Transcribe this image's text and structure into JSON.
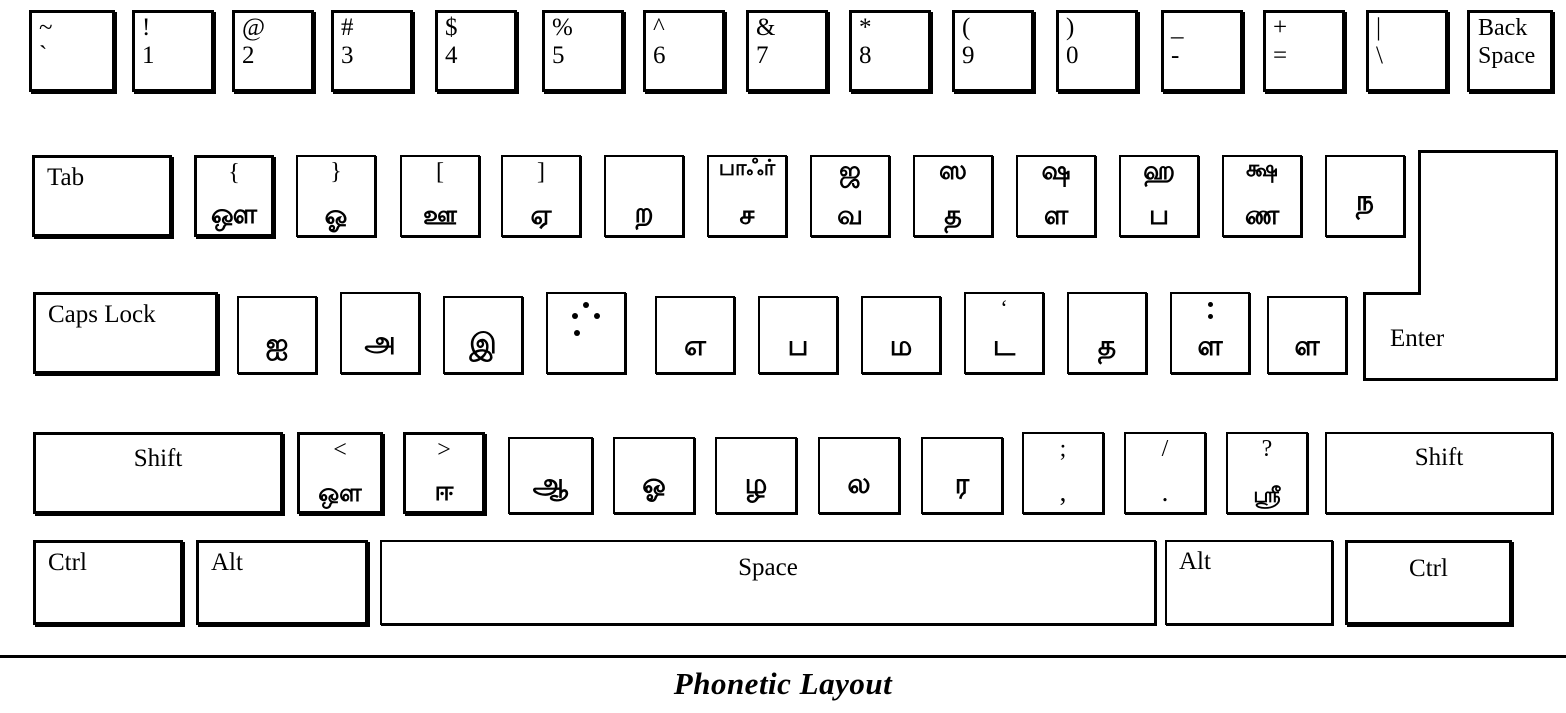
{
  "caption": "Phonetic Layout",
  "rows": {
    "number_row": [
      {
        "name": "key-backquote",
        "top": "~",
        "bottom": "`"
      },
      {
        "name": "key-1",
        "top": "!",
        "bottom": "1"
      },
      {
        "name": "key-2",
        "top": "@",
        "bottom": "2"
      },
      {
        "name": "key-3",
        "top": "#",
        "bottom": "3"
      },
      {
        "name": "key-4",
        "top": "$",
        "bottom": "4"
      },
      {
        "name": "key-5",
        "top": "%",
        "bottom": "5"
      },
      {
        "name": "key-6",
        "top": "^",
        "bottom": "6"
      },
      {
        "name": "key-7",
        "top": "&",
        "bottom": "7"
      },
      {
        "name": "key-8",
        "top": "*",
        "bottom": "8"
      },
      {
        "name": "key-9",
        "top": "(",
        "bottom": "9"
      },
      {
        "name": "key-0",
        "top": ")",
        "bottom": "0"
      },
      {
        "name": "key-minus",
        "top": "_",
        "bottom": "-"
      },
      {
        "name": "key-equals",
        "top": "+",
        "bottom": "="
      },
      {
        "name": "key-backslash",
        "top": "|",
        "bottom": "\\"
      },
      {
        "name": "key-backspace",
        "label": "Back\nSpace"
      }
    ],
    "tab_row": [
      {
        "name": "key-tab",
        "label": "Tab"
      },
      {
        "name": "key-q",
        "top": "{",
        "bottom": "ஔ"
      },
      {
        "name": "key-w",
        "top": "}",
        "bottom": "ஓ"
      },
      {
        "name": "key-e",
        "top": "[",
        "bottom": "ஊ"
      },
      {
        "name": "key-r",
        "top": "]",
        "bottom": "ஏ"
      },
      {
        "name": "key-t",
        "bottom": "ற"
      },
      {
        "name": "key-y",
        "top": "பாஃர்",
        "bottom": "ச"
      },
      {
        "name": "key-u",
        "top": "ஜ",
        "bottom": "வ"
      },
      {
        "name": "key-i",
        "top": "ஸ",
        "bottom": "த"
      },
      {
        "name": "key-o",
        "top": "ஷ",
        "bottom": "ள"
      },
      {
        "name": "key-p",
        "top": "ஹ",
        "bottom": "ப"
      },
      {
        "name": "key-bracketleft",
        "top": "க்ஷ",
        "bottom": "ண"
      },
      {
        "name": "key-bracketright",
        "bottom": "ந"
      }
    ],
    "caps_row": [
      {
        "name": "key-capslock",
        "label": "Caps Lock"
      },
      {
        "name": "key-a",
        "bottom": "ஐ"
      },
      {
        "name": "key-s",
        "bottom": "அ"
      },
      {
        "name": "key-d",
        "bottom": "இ"
      },
      {
        "name": "key-f",
        "glyph": "aytham"
      },
      {
        "name": "key-g",
        "bottom": "எ"
      },
      {
        "name": "key-h",
        "bottom": "ப"
      },
      {
        "name": "key-j",
        "top": "“",
        "bottom": "ம"
      },
      {
        "name": "key-k",
        "top": "‘",
        "bottom": "ட"
      },
      {
        "name": "key-l",
        "glyph": "twodot",
        "bottom": "த"
      },
      {
        "name": "key-semicolon",
        "bottom": "ள"
      }
    ],
    "shift_row": [
      {
        "name": "key-shift-left",
        "label": "Shift"
      },
      {
        "name": "key-z",
        "top": "<",
        "bottom": "ஒள"
      },
      {
        "name": "key-x",
        "top": ">",
        "bottom": "ஈ"
      },
      {
        "name": "key-c",
        "bottom": "ஆ"
      },
      {
        "name": "key-v",
        "bottom": "ஓ"
      },
      {
        "name": "key-b",
        "bottom": "ழ"
      },
      {
        "name": "key-n",
        "bottom": "ல"
      },
      {
        "name": "key-m",
        "bottom": "ர"
      },
      {
        "name": "key-comma",
        "top": ";",
        "bottom": ","
      },
      {
        "name": "key-period",
        "top": "/",
        "bottom": "."
      },
      {
        "name": "key-slash",
        "top": "?",
        "bottom": "ஸ்ரீ"
      },
      {
        "name": "key-shift-right",
        "label": "Shift"
      }
    ],
    "bottom_row": [
      {
        "name": "key-ctrl-left",
        "label": "Ctrl"
      },
      {
        "name": "key-alt-left",
        "label": "Alt"
      },
      {
        "name": "key-space",
        "label": "Space"
      },
      {
        "name": "key-alt-right",
        "label": "Alt"
      },
      {
        "name": "key-ctrl-right",
        "label": "Ctrl"
      }
    ],
    "enter": {
      "name": "key-enter",
      "label": "Enter"
    }
  }
}
